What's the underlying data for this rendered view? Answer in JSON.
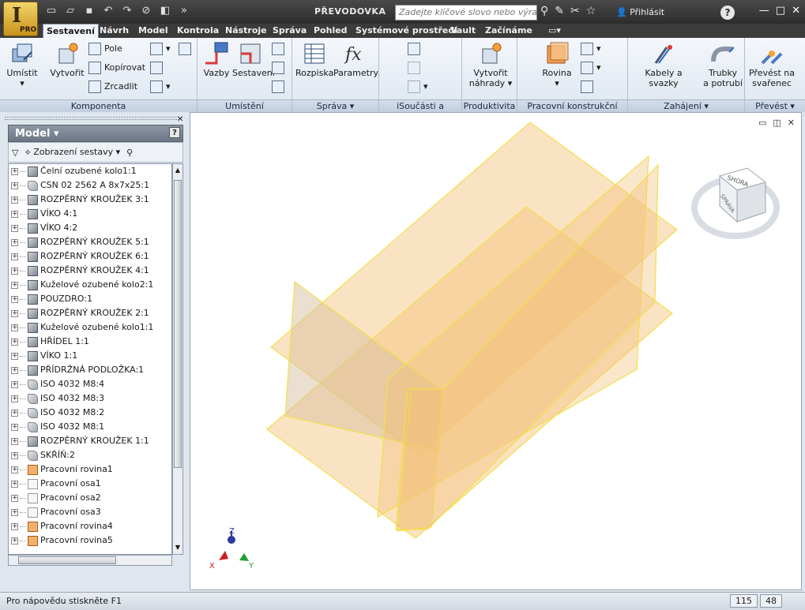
{
  "app": {
    "badge": "PRO",
    "window_title": "PŘEVODOVKA",
    "search_placeholder": "Zadejte klíčové slovo nebo výraz.",
    "sign_in": "Přihlásit"
  },
  "tabs": [
    "Sestavení",
    "Návrh",
    "Model",
    "Kontrola",
    "Nástroje",
    "Správa",
    "Pohled",
    "Systémové prostředí",
    "Vault",
    "Začínáme"
  ],
  "active_tab": "Sestavení",
  "ribbon": {
    "komponenta": {
      "label": "Komponenta",
      "umistit": "Umístit",
      "vytvorit": "Vytvořit",
      "pole": "Pole",
      "kopirovat": "Kopírovat",
      "zrcadlit": "Zrcadlit"
    },
    "umisteni": {
      "label": "Umístění",
      "vazby": "Vazby",
      "sestaveni": "Sestavení"
    },
    "sprava": {
      "label": "Správa",
      "rozpiska": "Rozpiska",
      "parametry": "Parametry"
    },
    "isoucasti": {
      "label": "iSoučásti a iSestavy"
    },
    "produktivita": {
      "label": "Produktivita",
      "vytvorit_nahrady_1": "Vytvořit",
      "vytvorit_nahrady_2": "náhrady"
    },
    "pracovni": {
      "label": "Pracovní konstrukční prvky",
      "rovina": "Rovina"
    },
    "zahajeni": {
      "label": "Zahájení",
      "kabely": "Kabely a svazky",
      "trubky_1": "Trubky",
      "trubky_2": "a potrubí"
    },
    "prevest": {
      "label": "Převést",
      "prevest_1": "Převést na",
      "prevest_2": "svařenec"
    }
  },
  "browser": {
    "title": "Model",
    "filter_label": "Zobrazení sestavy",
    "items": [
      {
        "label": "Čelní ozubené kolo1:1",
        "icon": "part"
      },
      {
        "label": "CSN 02 2562 A 8x7x25:1",
        "icon": "standard-part"
      },
      {
        "label": "ROZPĚRNÝ KROUŽEK 3:1",
        "icon": "part"
      },
      {
        "label": "VÍKO 4:1",
        "icon": "part"
      },
      {
        "label": "VÍKO 4:2",
        "icon": "part"
      },
      {
        "label": "ROZPĚRNÝ KROUŽEK 5:1",
        "icon": "part"
      },
      {
        "label": "ROZPĚRNÝ KROUŽEK 6:1",
        "icon": "part"
      },
      {
        "label": "ROZPĚRNÝ KROUŽEK 4:1",
        "icon": "part"
      },
      {
        "label": "Kuželové ozubené kolo2:1",
        "icon": "part"
      },
      {
        "label": "POUZDRO:1",
        "icon": "part"
      },
      {
        "label": "ROZPĚRNÝ KROUŽEK 2:1",
        "icon": "part"
      },
      {
        "label": "Kuželové ozubené kolo1:1",
        "icon": "part"
      },
      {
        "label": "HŘÍDEL 1:1",
        "icon": "part"
      },
      {
        "label": "VÍKO 1:1",
        "icon": "part"
      },
      {
        "label": "PŘÍDRŽNÁ PODLOŽKA:1",
        "icon": "part"
      },
      {
        "label": "ISO 4032 M8:4",
        "icon": "standard-part"
      },
      {
        "label": "ISO 4032 M8:3",
        "icon": "standard-part"
      },
      {
        "label": "ISO 4032 M8:2",
        "icon": "standard-part"
      },
      {
        "label": "ISO 4032 M8:1",
        "icon": "standard-part"
      },
      {
        "label": "ROZPĚRNÝ KROUŽEK 1:1",
        "icon": "part"
      },
      {
        "label": "SKŘÍŇ:2",
        "icon": "standard-part"
      },
      {
        "label": "Pracovní rovina1",
        "icon": "work-plane"
      },
      {
        "label": "Pracovní osa1",
        "icon": "work-axis"
      },
      {
        "label": "Pracovní osa2",
        "icon": "work-axis"
      },
      {
        "label": "Pracovní osa3",
        "icon": "work-axis"
      },
      {
        "label": "Pracovní rovina4",
        "icon": "work-plane"
      },
      {
        "label": "Pracovní rovina5",
        "icon": "work-plane"
      }
    ]
  },
  "viewcube": {
    "faces": [
      "SHORA",
      "SPRÁVA"
    ]
  },
  "triad": {
    "x": "X",
    "y": "Y",
    "z": "Z"
  },
  "status": {
    "help": "Pro nápovědu stiskněte F1",
    "count1": "115",
    "count2": "48"
  },
  "colors": {
    "work_plane_fill": "#f3c07a",
    "work_plane_edge": "#f2e04a",
    "accent": "#c8921c"
  }
}
